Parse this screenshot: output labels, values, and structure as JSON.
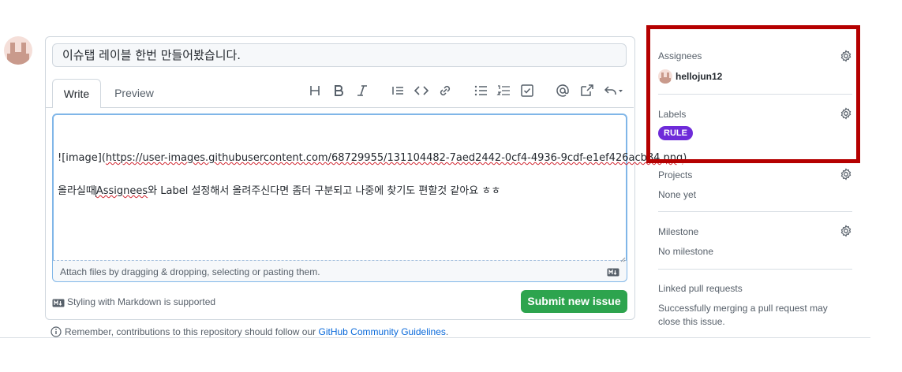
{
  "issue": {
    "title_value": "이슈탭 레이블 한번 만들어봤습니다.",
    "tabs": {
      "write": "Write",
      "preview": "Preview"
    },
    "body": {
      "image_prefix": "![image](",
      "image_url": "https://user-images.githubusercontent.com/68729955/131104482-7aed2442-0cf4-4936-9cdf-e1ef426acb84.png",
      "image_suffix": ")",
      "line2_part1": "올라실때",
      "line2_word": "Assignees",
      "line2_part2": "와 Label 설정해서 올려주신다면 좀더 구분되고 나중에 찾기도 편할것 같아요 ㅎㅎ"
    },
    "attach_hint": "Attach files by dragging & dropping, selecting or pasting them.",
    "markdown_note": "Styling with Markdown is supported",
    "submit_label": "Submit new issue",
    "remember_text": "Remember, contributions to this repository should follow our ",
    "remember_link": "GitHub Community Guidelines",
    "remember_end": "."
  },
  "toolbar_icons": [
    "heading-icon",
    "bold-icon",
    "italic-icon",
    "quote-icon",
    "code-icon",
    "link-icon",
    "bulleted-list-icon",
    "numbered-list-icon",
    "task-list-icon",
    "mention-icon",
    "cross-reference-icon",
    "reply-icon"
  ],
  "sidebar": {
    "assignees": {
      "heading": "Assignees",
      "user": "hellojun12"
    },
    "labels": {
      "heading": "Labels",
      "badge": "RULE",
      "badge_color": "#6e2bd9"
    },
    "projects": {
      "heading": "Projects",
      "value": "None yet"
    },
    "milestone": {
      "heading": "Milestone",
      "value": "No milestone"
    },
    "linked": {
      "heading": "Linked pull requests",
      "value": "Successfully merging a pull request may close this issue."
    }
  },
  "colors": {
    "submit": "#2da44e",
    "highlight_box": "#b50000",
    "link": "#0969da"
  }
}
